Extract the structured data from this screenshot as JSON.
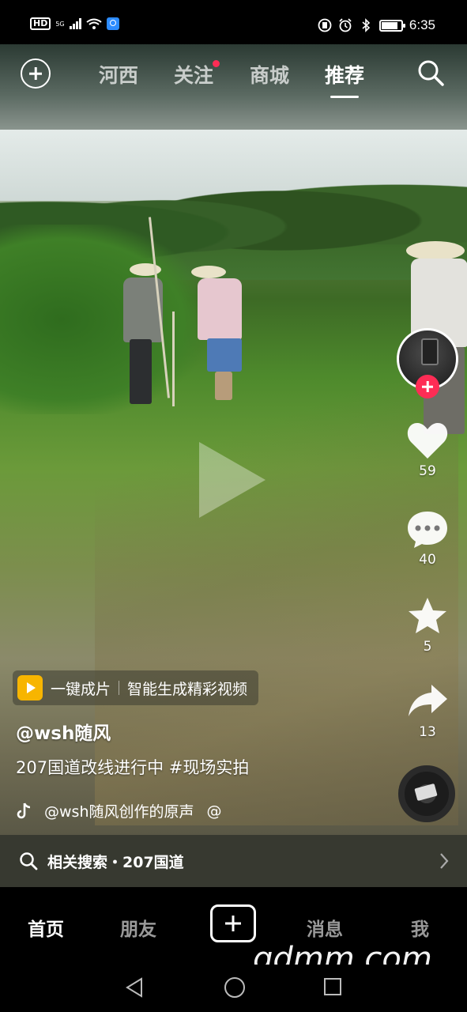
{
  "status_bar": {
    "hd_label": "HD",
    "network_label": "5G",
    "time": "6:35"
  },
  "top_nav": {
    "tabs": [
      {
        "label": "河西",
        "active": false,
        "dot": false
      },
      {
        "label": "关注",
        "active": false,
        "dot": true
      },
      {
        "label": "商城",
        "active": false,
        "dot": false
      },
      {
        "label": "推荐",
        "active": true,
        "dot": false
      }
    ],
    "left_icon": "plus-circle-icon",
    "right_icon": "search-icon"
  },
  "actions": {
    "likes": "59",
    "comments": "40",
    "favorites": "5",
    "shares": "13"
  },
  "video": {
    "template_chip": {
      "title": "一键成片",
      "subtitle": "智能生成精彩视频"
    },
    "author": "@wsh随风",
    "caption": "207国道改线进行中 #现场实拍",
    "music": "@wsh随风创作的原声",
    "music_tail": "@"
  },
  "related_search": {
    "label": "相关搜索・207国道"
  },
  "tab_bar": {
    "tabs": [
      {
        "label": "首页",
        "active": true
      },
      {
        "label": "朋友",
        "active": false
      },
      {
        "label": "消息",
        "active": false
      },
      {
        "label": "我",
        "active": false
      }
    ]
  },
  "watermark": "gdmm.com",
  "colors": {
    "accent_red": "#fe2c55",
    "chip_icon": "#f7b500"
  }
}
